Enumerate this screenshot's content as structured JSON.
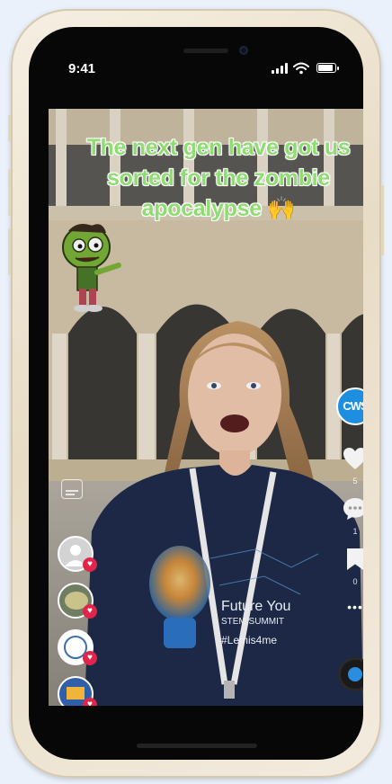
{
  "status_bar": {
    "time": "9:41"
  },
  "video": {
    "caption_lines": [
      "The next gen have got us",
      "sorted for the zombie",
      "apocalypse"
    ],
    "caption_emoji": "🙌",
    "shirt_text_line1": "Future You",
    "shirt_text_line2": "STEM SUMMIT",
    "shirt_text_line3": "#Lemis4me"
  },
  "profile": {
    "label": "CWS"
  },
  "actions": {
    "like_count": "5",
    "comment_count": "1",
    "bookmark_count": "0",
    "more_label": "•••"
  },
  "left_rail": {
    "avatars": [
      "viewer-1",
      "viewer-2",
      "viewer-3",
      "viewer-4"
    ]
  },
  "colors": {
    "caption": "#8fdc72",
    "badge": "#e0244a",
    "profile": "#1e8fe0"
  }
}
